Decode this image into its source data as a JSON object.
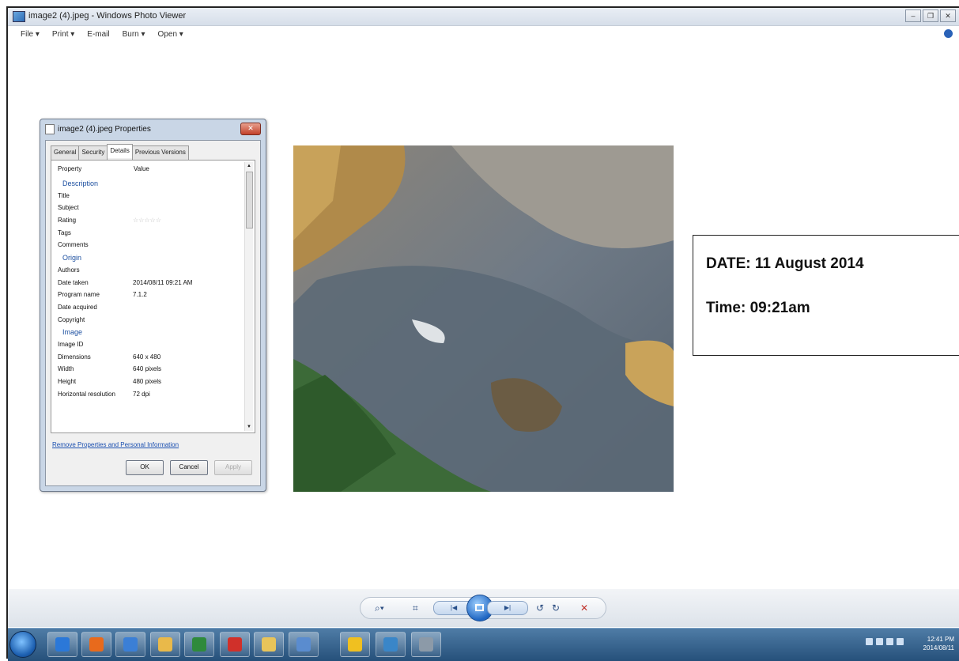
{
  "window": {
    "title": "image2 (4).jpeg - Windows Photo Viewer",
    "controls": [
      "–",
      "❐",
      "✕"
    ]
  },
  "menu": {
    "items": [
      "File  ▾",
      "Print  ▾",
      "E-mail",
      "Burn  ▾",
      "Open  ▾"
    ]
  },
  "dialog": {
    "title": "image2 (4).jpeg Properties",
    "close": "✕",
    "tabs": [
      "General",
      "Security",
      "Details",
      "Previous Versions"
    ],
    "active_tab": "Details",
    "header_property": "Property",
    "header_value": "Value",
    "rows": [
      {
        "label": "Description",
        "value": "",
        "group": true
      },
      {
        "label": "Title",
        "value": ""
      },
      {
        "label": "Subject",
        "value": ""
      },
      {
        "label": "Rating",
        "value": "☆☆☆☆☆"
      },
      {
        "label": "Tags",
        "value": ""
      },
      {
        "label": "Comments",
        "value": ""
      },
      {
        "label": "Origin",
        "value": "",
        "group": true
      },
      {
        "label": "Authors",
        "value": ""
      },
      {
        "label": "Date taken",
        "value": "2014/08/11 09:21 AM"
      },
      {
        "label": "Program name",
        "value": "7.1.2"
      },
      {
        "label": "Date acquired",
        "value": ""
      },
      {
        "label": "Copyright",
        "value": ""
      },
      {
        "label": "Image",
        "value": "",
        "group": true
      },
      {
        "label": "Image ID",
        "value": ""
      },
      {
        "label": "Dimensions",
        "value": "640 x 480"
      },
      {
        "label": "Width",
        "value": "640 pixels"
      },
      {
        "label": "Height",
        "value": "480 pixels"
      },
      {
        "label": "Horizontal resolution",
        "value": "72 dpi"
      }
    ],
    "remove_link": "Remove Properties and Personal Information",
    "buttons": {
      "ok": "OK",
      "cancel": "Cancel",
      "apply": "Apply"
    }
  },
  "annotation": {
    "date": "DATE: 11 August 2014",
    "time": "Time: 09:21am"
  },
  "viewer_toolbar": {
    "zoom": "⌕▾",
    "fit": "⌗",
    "prev": "|◀",
    "next": "▶|",
    "rotate_ccw": "↺",
    "rotate_cw": "↻",
    "delete": "✕"
  },
  "taskbar": {
    "time": "12:41 PM",
    "date": "2014/08/11",
    "app_colors": [
      "#2b78d8",
      "#e86a1c",
      "#3b7fd6",
      "#e9b94a",
      "#2f8a3c",
      "#d0302a",
      "#e8c45a",
      "#5a8ccf",
      "#f0c020",
      "#3a86c8",
      "#8c9aa8"
    ]
  }
}
